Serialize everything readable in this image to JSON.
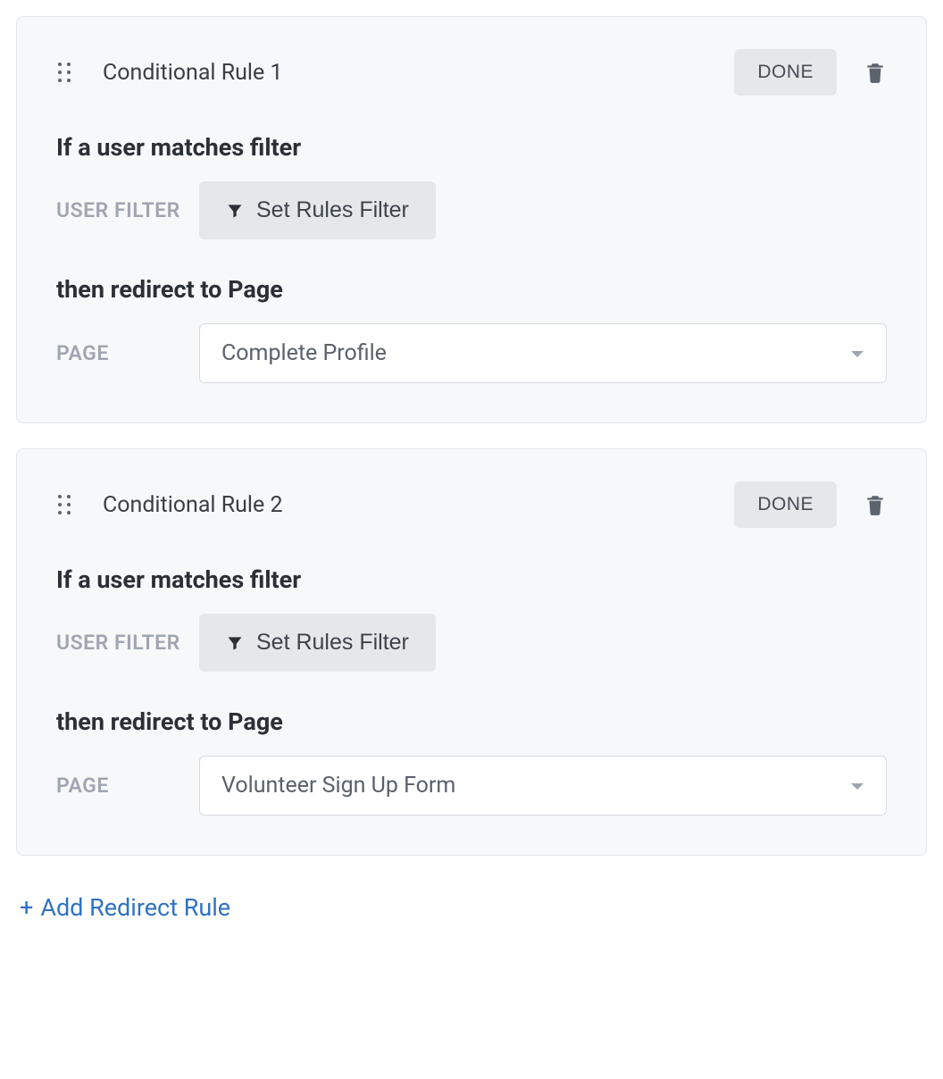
{
  "labels": {
    "done": "DONE",
    "filter_heading": "If a user matches filter",
    "user_filter_label": "USER FILTER",
    "set_rules_filter": "Set Rules Filter",
    "redirect_heading": "then redirect to Page",
    "page_label": "PAGE",
    "add_rule": "Add Redirect Rule"
  },
  "rules": [
    {
      "title": "Conditional Rule 1",
      "page": "Complete Profile"
    },
    {
      "title": "Conditional Rule 2",
      "page": "Volunteer Sign Up Form"
    }
  ]
}
